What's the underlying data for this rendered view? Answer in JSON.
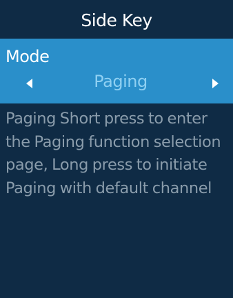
{
  "header": {
    "title": "Side Key"
  },
  "mode": {
    "label": "Mode",
    "value": "Paging",
    "prev_icon": "triangle-left-icon",
    "next_icon": "triangle-right-icon"
  },
  "description": {
    "text": "Paging Short press to enter the Paging function selection page, Long press to initiate Paging with default channel"
  },
  "colors": {
    "background": "#0f2b45",
    "highlight": "#2a8fca",
    "value_text": "#8fd0f2",
    "description_text": "#8a9cab"
  }
}
